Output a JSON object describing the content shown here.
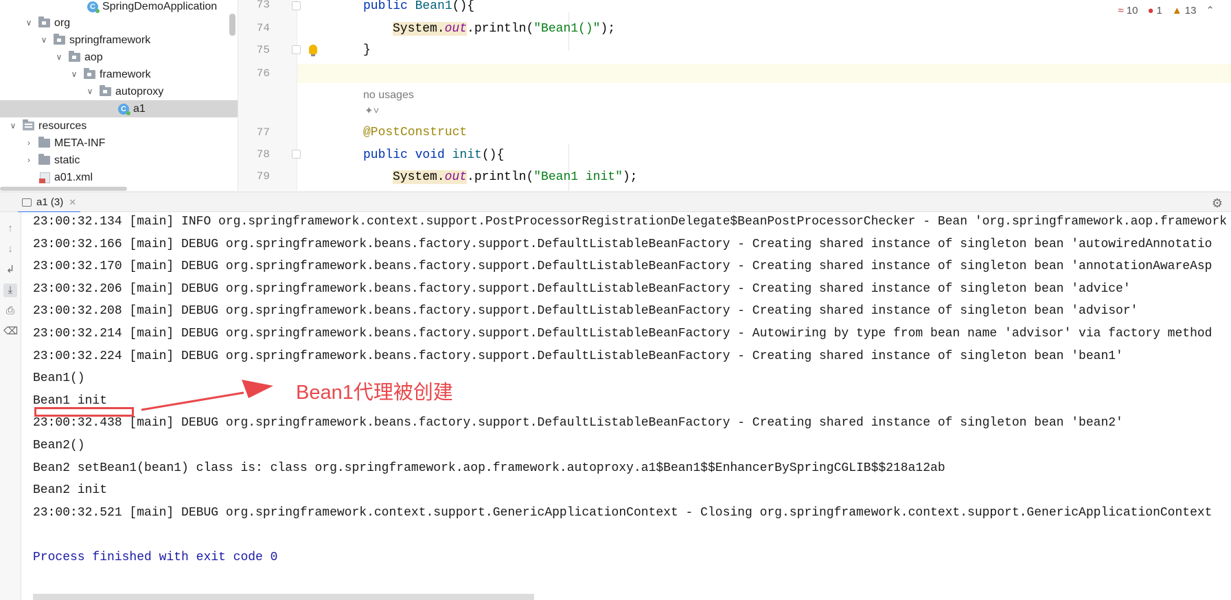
{
  "project_tree": {
    "items": [
      {
        "label": "SpringDemoApplication",
        "type": "class",
        "depth": 5,
        "expanded": null
      },
      {
        "label": "org",
        "type": "package",
        "depth": 2,
        "expanded": true
      },
      {
        "label": "springframework",
        "type": "package",
        "depth": 3,
        "expanded": true
      },
      {
        "label": "aop",
        "type": "package",
        "depth": 4,
        "expanded": true
      },
      {
        "label": "framework",
        "type": "package",
        "depth": 5,
        "expanded": true
      },
      {
        "label": "autoproxy",
        "type": "package",
        "depth": 6,
        "expanded": true
      },
      {
        "label": "a1",
        "type": "class",
        "depth": 7,
        "expanded": null,
        "selected": true
      },
      {
        "label": "resources",
        "type": "resources-folder",
        "depth": 0,
        "expanded": true
      },
      {
        "label": "META-INF",
        "type": "folder",
        "depth": 1,
        "expanded": false
      },
      {
        "label": "static",
        "type": "folder",
        "depth": 1,
        "expanded": false
      },
      {
        "label": "a01.xml",
        "type": "xml-file",
        "depth": 1,
        "expanded": null
      }
    ]
  },
  "editor": {
    "inspections": {
      "typos": "10",
      "errors": "1",
      "warnings": "13"
    },
    "line_numbers": [
      "73",
      "74",
      "75",
      "76",
      "77",
      "78",
      "79"
    ],
    "code": {
      "l73_kw": "public ",
      "l73_name": "Bean1",
      "l73_rest": "(){",
      "l74_sys": "System.",
      "l74_out": "out",
      "l74_call": ".println(",
      "l74_str": "\"Bean1()\"",
      "l74_end": ");",
      "l75": "}",
      "hint_usages": "no usages",
      "l77_ann": "@PostConstruct",
      "l78_kw": "public void ",
      "l78_name": "init",
      "l78_rest": "(){",
      "l79_sys": "System.",
      "l79_out": "out",
      "l79_call": ".println(",
      "l79_str": "\"Bean1 init\"",
      "l79_end": ");"
    }
  },
  "run_window": {
    "tab_label": "a1 (3)",
    "console_lines": [
      "23:00:32.134 [main] INFO org.springframework.context.support.PostProcessorRegistrationDelegate$BeanPostProcessorChecker - Bean 'org.springframework.aop.framework",
      "23:00:32.166 [main] DEBUG org.springframework.beans.factory.support.DefaultListableBeanFactory - Creating shared instance of singleton bean 'autowiredAnnotatio",
      "23:00:32.170 [main] DEBUG org.springframework.beans.factory.support.DefaultListableBeanFactory - Creating shared instance of singleton bean 'annotationAwareAsp",
      "23:00:32.206 [main] DEBUG org.springframework.beans.factory.support.DefaultListableBeanFactory - Creating shared instance of singleton bean 'advice'",
      "23:00:32.208 [main] DEBUG org.springframework.beans.factory.support.DefaultListableBeanFactory - Creating shared instance of singleton bean 'advisor'",
      "23:00:32.214 [main] DEBUG org.springframework.beans.factory.support.DefaultListableBeanFactory - Autowiring by type from bean name 'advisor' via factory method",
      "23:00:32.224 [main] DEBUG org.springframework.beans.factory.support.DefaultListableBeanFactory - Creating shared instance of singleton bean 'bean1'",
      "Bean1()",
      "Bean1 init",
      "23:00:32.438 [main] DEBUG org.springframework.beans.factory.support.DefaultListableBeanFactory - Creating shared instance of singleton bean 'bean2'",
      "Bean2()",
      "Bean2 setBean1(bean1) class is: class org.springframework.aop.framework.autoproxy.a1$Bean1$$EnhancerBySpringCGLIB$$218a12ab",
      "Bean2 init",
      "23:00:32.521 [main] DEBUG org.springframework.context.support.GenericApplicationContext - Closing org.springframework.context.support.GenericApplicationContext",
      "",
      "Process finished with exit code 0"
    ]
  },
  "annotation": {
    "text": "Bean1代理被创建",
    "color": "#e8484b"
  }
}
